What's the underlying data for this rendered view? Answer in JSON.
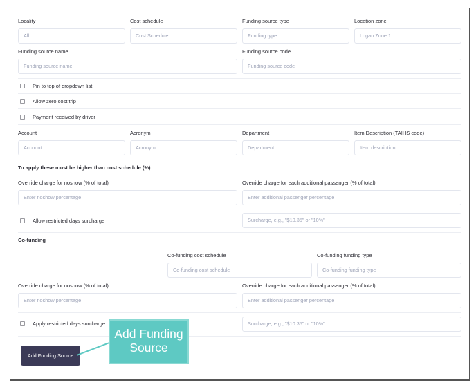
{
  "row1": {
    "locality": {
      "label": "Locality",
      "placeholder": "All"
    },
    "cost_schedule": {
      "label": "Cost schedule",
      "placeholder": "Cost Schedule"
    },
    "funding_source_type": {
      "label": "Funding source type",
      "placeholder": "Funding type"
    },
    "location_zone": {
      "label": "Location zone",
      "placeholder": "Logan Zone 1"
    }
  },
  "row2": {
    "funding_source_name": {
      "label": "Funding source name",
      "placeholder": "Funding source name"
    },
    "funding_source_code": {
      "label": "Funding source code",
      "placeholder": "Funding source code"
    }
  },
  "checkboxes": {
    "pin_to_top": {
      "label": "Pin to top of dropdown list",
      "checked": false
    },
    "allow_zero_cost": {
      "label": "Allow zero cost trip",
      "checked": false
    },
    "payment_by_driver": {
      "label": "Payment received by driver",
      "checked": false
    }
  },
  "row3": {
    "account": {
      "label": "Account",
      "placeholder": "Account"
    },
    "acronym": {
      "label": "Acronym",
      "placeholder": "Acronym"
    },
    "department": {
      "label": "Department",
      "placeholder": "Department"
    },
    "item_description": {
      "label": "Item Description (TAIHS code)",
      "placeholder": "Item description"
    }
  },
  "override_section": {
    "heading": "To apply these must be higher than cost schedule (%)",
    "noshow": {
      "label": "Override charge for noshow (% of total)",
      "placeholder": "Enter noshow percentage"
    },
    "additional_passenger": {
      "label": "Override charge for each additional passenger (% of total)",
      "placeholder": "Enter additional passenger percentage"
    },
    "restricted_days": {
      "label": "Allow restricted days surcharge",
      "checked": false
    },
    "surcharge": {
      "placeholder": "Surcharge, e.g., \"$10.35\" or \"10%\""
    }
  },
  "cofunding": {
    "heading": "Co-funding",
    "cost_schedule": {
      "label": "Co-funding cost schedule",
      "placeholder": "Co-funding cost schedule"
    },
    "funding_type": {
      "label": "Co-funding funding type",
      "placeholder": "Co-funding funding type"
    },
    "noshow": {
      "label": "Override charge for noshow (% of total)",
      "placeholder": "Enter noshow percentage"
    },
    "additional_passenger": {
      "label": "Override charge for each additional passenger (% of total)",
      "placeholder": "Enter additional passenger percentage"
    },
    "restricted_days": {
      "label": "Apply restricted days surcharge",
      "checked": false
    },
    "surcharge": {
      "placeholder": "Surcharge, e.g., \"$10.35\" or \"10%\""
    }
  },
  "actions": {
    "add_label": "Add Funding Source"
  },
  "annotation": {
    "text": "Add Funding Source",
    "color": "#5ec9c3"
  },
  "colors": {
    "button_bg": "#3b3a57",
    "placeholder": "#9ea4b8",
    "border": "#e3e6ee"
  }
}
